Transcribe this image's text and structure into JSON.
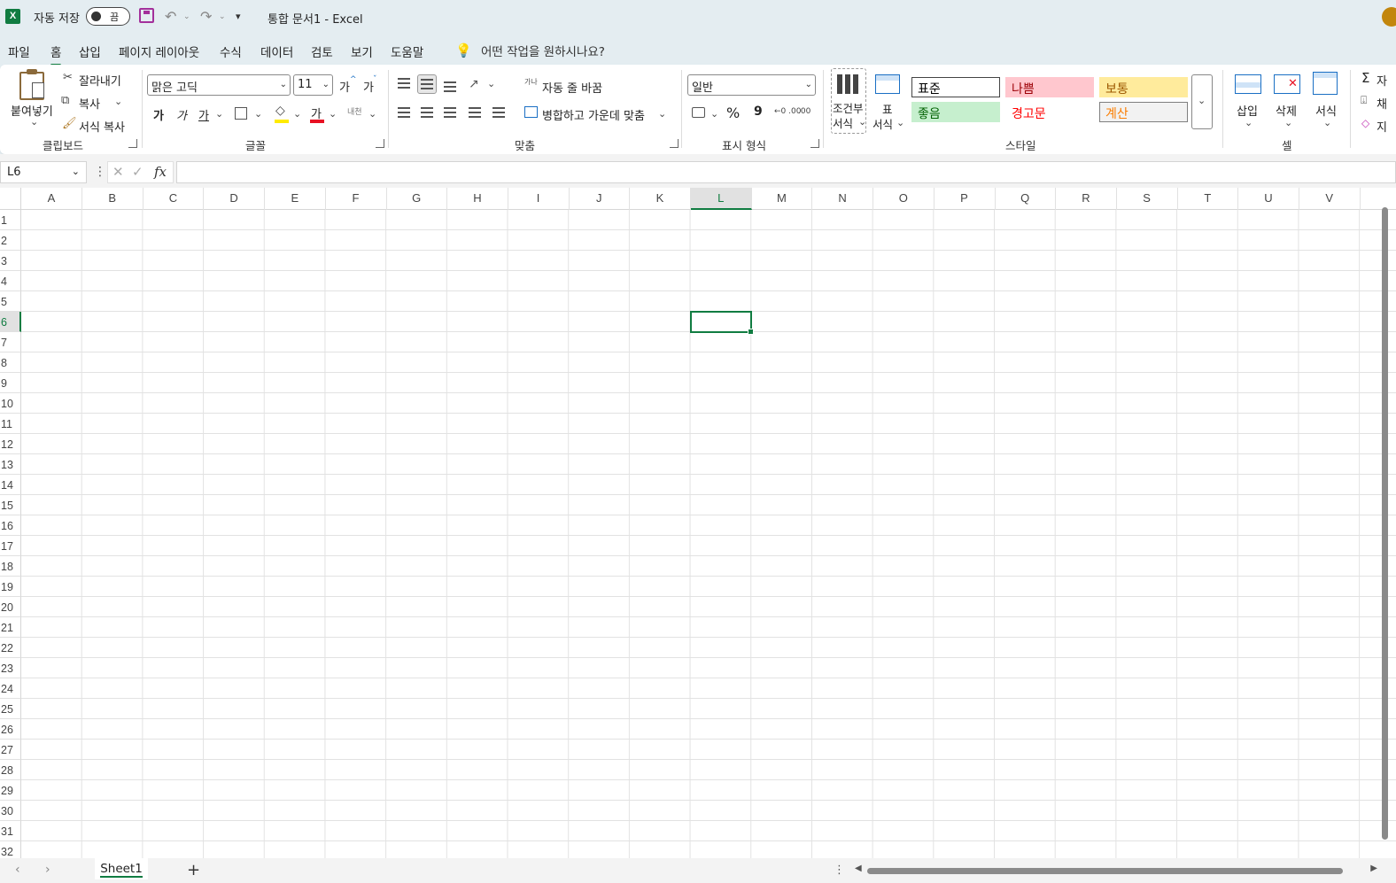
{
  "titlebar": {
    "app_logo": "X",
    "autosave_label": "자동 저장",
    "autosave_state": "끔",
    "document_title": "통합 문서1  -  Excel"
  },
  "menu": {
    "items": [
      {
        "label": "파일",
        "active": false
      },
      {
        "label": "홈",
        "active": true
      },
      {
        "label": "삽입",
        "active": false
      },
      {
        "label": "페이지 레이아웃",
        "active": false
      },
      {
        "label": "수식",
        "active": false
      },
      {
        "label": "데이터",
        "active": false
      },
      {
        "label": "검토",
        "active": false
      },
      {
        "label": "보기",
        "active": false
      },
      {
        "label": "도움말",
        "active": false
      }
    ],
    "search_hint": "어떤 작업을 원하시나요?"
  },
  "ribbon": {
    "clipboard": {
      "paste": "붙여넣기",
      "cut": "잘라내기",
      "copy": "복사",
      "format_painter": "서식 복사",
      "group_label": "클립보드"
    },
    "font": {
      "font_name": "맑은 고딕",
      "font_size": "11",
      "grow": "가",
      "shrink": "가",
      "bold": "가",
      "italic": "가",
      "underline": "가",
      "font_color_glyph": "가",
      "phonetic": "내천",
      "group_label": "글꼴",
      "colors": {
        "highlight": "#ffeb00",
        "font_color": "#e81123"
      }
    },
    "alignment": {
      "wrap_text": "자동 줄 바꿈",
      "merge_center": "병합하고 가운데 맞춤",
      "wrap_icon_text": "가나",
      "group_label": "맞춤"
    },
    "number": {
      "format": "일반",
      "percent": "%",
      "comma": "9",
      "group_label": "표시 형식"
    },
    "styles": {
      "conditional_line1": "조건부",
      "conditional_line2": "서식",
      "table_line1": "표",
      "table_line2": "서식",
      "cells": [
        {
          "label": "표준",
          "bg": "#ffffff",
          "color": "#000000",
          "border": "#444444"
        },
        {
          "label": "나쁨",
          "bg": "#ffc7ce",
          "color": "#9c0006",
          "border": "#ffc7ce"
        },
        {
          "label": "보통",
          "bg": "#ffeb9c",
          "color": "#9c5700",
          "border": "#ffeb9c"
        },
        {
          "label": "좋음",
          "bg": "#c6efce",
          "color": "#006100",
          "border": "#c6efce"
        },
        {
          "label": "경고문",
          "bg": "#ffffff",
          "color": "#ff0000",
          "border": "#ffffff"
        },
        {
          "label": "계산",
          "bg": "#f2f2f2",
          "color": "#fa7d00",
          "border": "#7f7f7f"
        }
      ],
      "group_label": "스타일"
    },
    "cells": {
      "insert": "삽입",
      "delete": "삭제",
      "format": "서식",
      "group_label": "셀"
    },
    "editing": {
      "autosum": "자",
      "fill": "채",
      "clear": "지"
    }
  },
  "formula_bar": {
    "name_box": "L6",
    "fx": "fx",
    "formula": ""
  },
  "grid": {
    "columns": [
      "A",
      "B",
      "C",
      "D",
      "E",
      "F",
      "G",
      "H",
      "I",
      "J",
      "K",
      "L",
      "M",
      "N",
      "O",
      "P",
      "Q",
      "R",
      "S",
      "T",
      "U",
      "V"
    ],
    "rows": [
      "1",
      "2",
      "3",
      "4",
      "5",
      "6",
      "7",
      "8",
      "9",
      "10",
      "11",
      "12",
      "13",
      "14",
      "15",
      "16",
      "17",
      "18",
      "19",
      "20",
      "21",
      "22",
      "23",
      "24",
      "25",
      "26",
      "27",
      "28",
      "29",
      "30",
      "31",
      "32"
    ],
    "selected_column": "L",
    "selected_row": "6"
  },
  "sheets": {
    "tabs": [
      "Sheet1"
    ],
    "add": "+"
  },
  "theme": {
    "accent": "#107c41",
    "chrome_bg": "#e4edf1"
  }
}
